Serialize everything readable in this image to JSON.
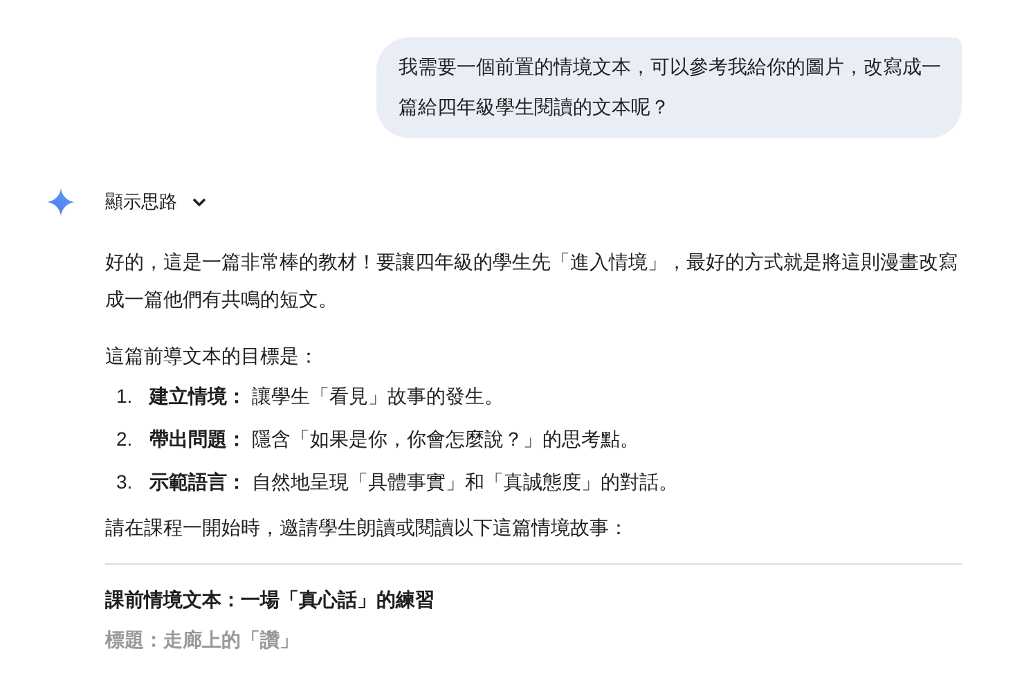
{
  "user_message": {
    "text": "我需要一個前置的情境文本，可以參考我給你的圖片，改寫成一篇給四年級學生閱讀的文本呢？"
  },
  "thoughts_toggle": {
    "label": "顯示思路",
    "expanded": false
  },
  "response": {
    "intro": "好的，這是一篇非常棒的教材！要讓四年級的學生先「進入情境」，最好的方式就是將這則漫畫改寫成一篇他們有共鳴的短文。",
    "goals_heading": "這篇前導文本的目標是：",
    "goals": [
      {
        "number": "1.",
        "term": "建立情境：",
        "text": "讓學生「看見」故事的發生。"
      },
      {
        "number": "2.",
        "term": "帶出問題：",
        "text": "隱含「如果是你，你會怎麼說？」的思考點。"
      },
      {
        "number": "3.",
        "term": "示範語言：",
        "text": "自然地呈現「具體事實」和「真誠態度」的對話。"
      }
    ],
    "invite": "請在課程一開始時，邀請學生朗讀或閱讀以下這篇情境故事：",
    "story_heading": "課前情境文本：一場「真心話」的練習",
    "story_title": "標題：走廊上的「讚」"
  }
}
